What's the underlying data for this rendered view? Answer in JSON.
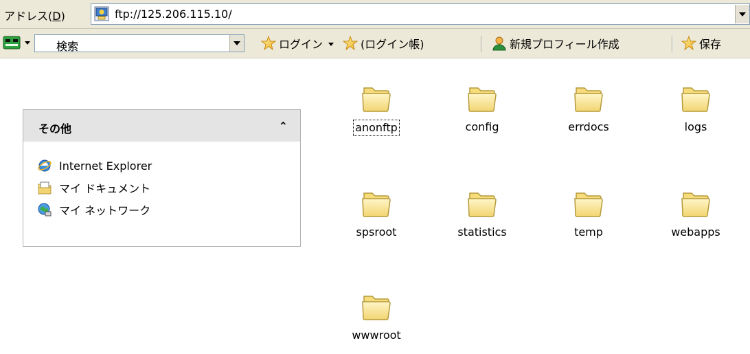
{
  "address_bar": {
    "label": "アドレス",
    "shortcut": "D",
    "url": "ftp://125.206.115.10/"
  },
  "toolbar": {
    "search_value": "検索",
    "login_label": "ログイン",
    "login_account_label": "(ログイン帳)",
    "new_profile_label": "新規プロフィール作成",
    "save_label": "保存"
  },
  "task_pane": {
    "title": "その他",
    "collapse_glyph": "⌃",
    "items": [
      {
        "label": "Internet Explorer",
        "icon": "internet-explorer-icon"
      },
      {
        "label": "マイ ドキュメント",
        "icon": "my-documents-icon"
      },
      {
        "label": "マイ ネットワーク",
        "icon": "my-network-icon"
      }
    ]
  },
  "folders": [
    {
      "name": "anonftp"
    },
    {
      "name": "config"
    },
    {
      "name": "errdocs"
    },
    {
      "name": "logs"
    },
    {
      "name": "spsroot"
    },
    {
      "name": "statistics"
    },
    {
      "name": "temp"
    },
    {
      "name": "webapps"
    },
    {
      "name": "wwwroot"
    }
  ],
  "colors": {
    "chrome": "#ece9d8",
    "folder_fill": "#fbe69c",
    "folder_stroke": "#b59a3c"
  }
}
